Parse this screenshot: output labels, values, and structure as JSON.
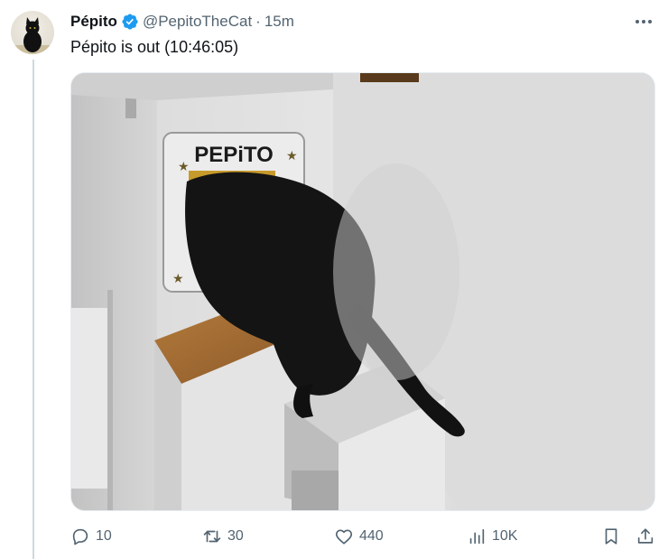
{
  "tweet": {
    "display_name": "Pépito",
    "handle": "@PepitoTheCat",
    "separator": "·",
    "time": "15m",
    "text": "Pépito is out (10:46:05)",
    "image_sign_text": "PEPiTO"
  },
  "actions": {
    "reply_count": "10",
    "repost_count": "30",
    "like_count": "440",
    "views_count": "10K"
  },
  "colors": {
    "verified": "#1d9bf0",
    "icon_gray": "#536471",
    "thread_line": "#cfd9de"
  },
  "icons": [
    "verified-badge-icon",
    "more-icon",
    "reply-icon",
    "repost-icon",
    "like-icon",
    "views-icon",
    "bookmark-icon",
    "share-icon"
  ]
}
